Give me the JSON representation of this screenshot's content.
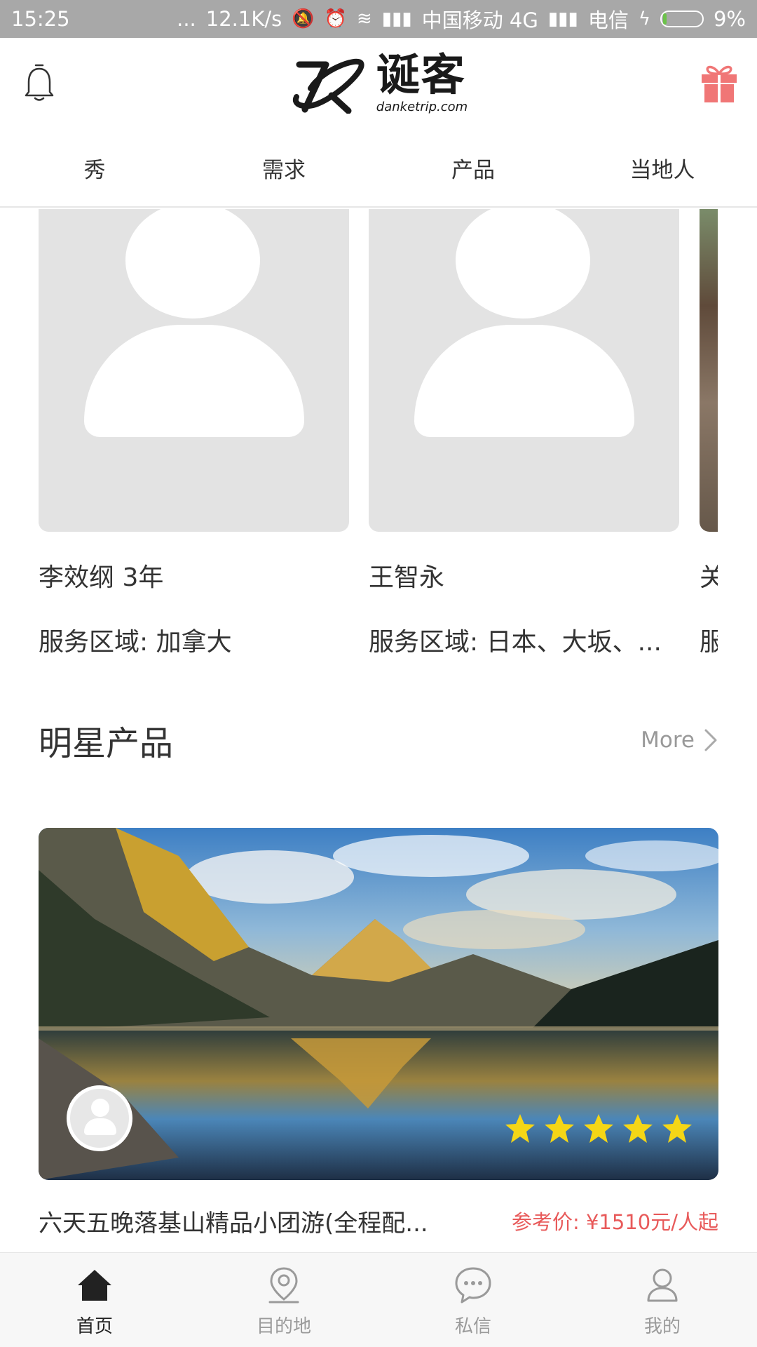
{
  "status_bar": {
    "time": "15:25",
    "dots": "...",
    "speed": "12.1K/s",
    "carrier1": "中国移动 4G",
    "carrier2": "电信",
    "battery": "9%",
    "battery_level": 0.09
  },
  "header": {
    "logo_cn": "诞客",
    "logo_domain": "danketrip.com",
    "icons": [
      "bell-icon",
      "gift-icon"
    ],
    "accent_color": "#f07676"
  },
  "tabs": [
    {
      "label": "秀"
    },
    {
      "label": "需求"
    },
    {
      "label": "产品"
    },
    {
      "label": "当地人"
    }
  ],
  "people": [
    {
      "name": "李效纲 3年",
      "area": "服务区域: 加拿大"
    },
    {
      "name": "王智永",
      "area": "服务区域: 日本、大坂、..."
    },
    {
      "name": "关",
      "area": "服"
    }
  ],
  "section": {
    "title": "明星产品",
    "more": "More"
  },
  "product": {
    "title": "六天五晚落基山精品小团游(全程配...",
    "price": "参考价: ¥1510元/人起",
    "rating": 5
  },
  "bottom_nav": [
    {
      "label": "首页",
      "icon": "home-icon",
      "active": true
    },
    {
      "label": "目的地",
      "icon": "location-pin-icon",
      "active": false
    },
    {
      "label": "私信",
      "icon": "chat-bubble-icon",
      "active": false
    },
    {
      "label": "我的",
      "icon": "user-icon",
      "active": false
    }
  ]
}
